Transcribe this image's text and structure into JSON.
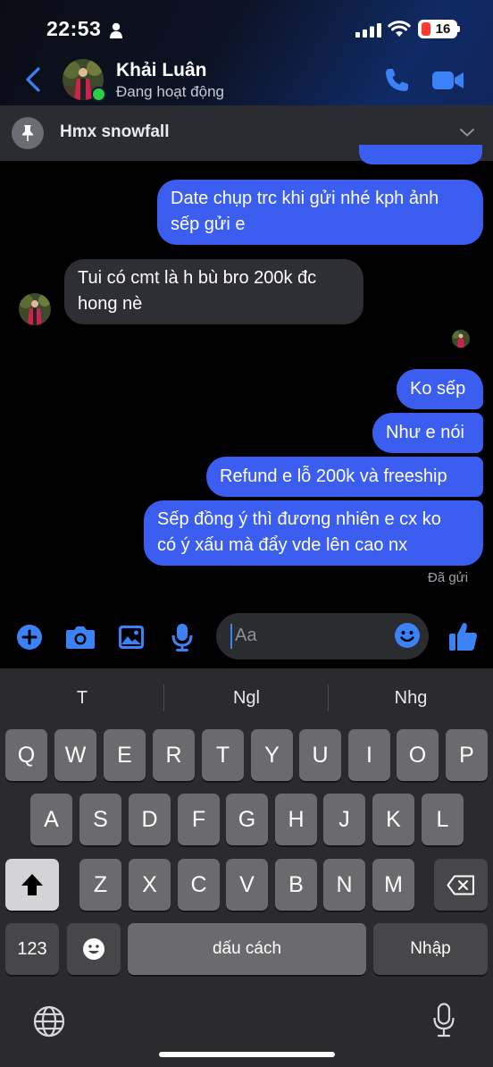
{
  "status_bar": {
    "time": "22:53",
    "battery": "16"
  },
  "header": {
    "contact_name": "Khải Luân",
    "contact_status": "Đang hoạt động",
    "icons": [
      "back-icon",
      "phone-icon",
      "video-icon"
    ]
  },
  "pinned": {
    "title": "Hmx snowfall"
  },
  "messages": [
    {
      "from": "me",
      "text": [
        "Date chụp trc khi gửi nhé kph ảnh",
        "sếp gửi e"
      ]
    },
    {
      "from": "them",
      "text": [
        "Tui có cmt là h bù bro 200k đc",
        "hong nè"
      ]
    },
    {
      "from": "me",
      "text": [
        "Ko sếp"
      ]
    },
    {
      "from": "me",
      "text": [
        "Như e nói"
      ]
    },
    {
      "from": "me",
      "text": [
        "Refund e lỗ 200k và freeship"
      ]
    },
    {
      "from": "me",
      "text": [
        "Sếp đồng ý thì đương nhiên e cx ko",
        "có ý xấu mà đẩy vde lên cao nx"
      ]
    }
  ],
  "sent_status": "Đã gửi",
  "composer": {
    "placeholder": "Aa",
    "icons": [
      "plus-icon",
      "camera-icon",
      "image-icon",
      "microphone-icon",
      "emoji-icon",
      "like-icon"
    ]
  },
  "keyboard": {
    "suggestions": [
      "T",
      "Ngl",
      "Nhg"
    ],
    "row1": [
      "Q",
      "W",
      "E",
      "R",
      "T",
      "Y",
      "U",
      "I",
      "O",
      "P"
    ],
    "row2": [
      "A",
      "S",
      "D",
      "F",
      "G",
      "H",
      "J",
      "K",
      "L"
    ],
    "row3": [
      "Z",
      "X",
      "C",
      "V",
      "B",
      "N",
      "M"
    ],
    "numbers_key": "123",
    "space_key": "dấu cách",
    "return_key": "Nhập"
  },
  "colors": {
    "outgoing_bubble": "#3b5ef0",
    "incoming_bubble": "#2e2f34",
    "accent": "#3b82f6",
    "online": "#31cc46"
  }
}
